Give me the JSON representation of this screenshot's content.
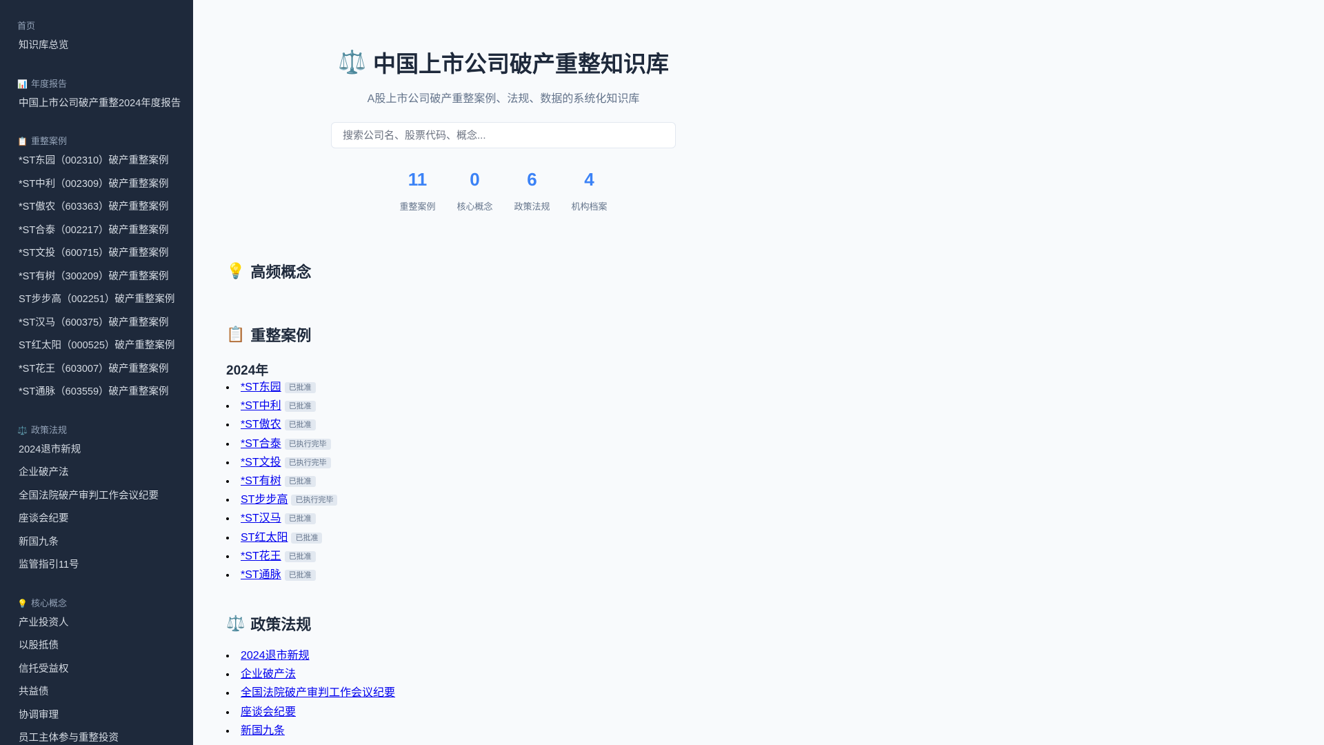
{
  "sidebar": {
    "sections": [
      {
        "title": "首页",
        "icon": "",
        "items": [
          "知识库总览"
        ]
      },
      {
        "title": "年度报告",
        "icon": "📊",
        "items": [
          "中国上市公司破产重整2024年度报告"
        ]
      },
      {
        "title": "重整案例",
        "icon": "📋",
        "items": [
          "*ST东园（002310）破产重整案例",
          "*ST中利（002309）破产重整案例",
          "*ST傲农（603363）破产重整案例",
          "*ST合泰（002217）破产重整案例",
          "*ST文投（600715）破产重整案例",
          "*ST有树（300209）破产重整案例",
          "ST步步高（002251）破产重整案例",
          "*ST汉马（600375）破产重整案例",
          "ST红太阳（000525）破产重整案例",
          "*ST花王（603007）破产重整案例",
          "*ST通脉（603559）破产重整案例"
        ]
      },
      {
        "title": "政策法规",
        "icon": "⚖️",
        "items": [
          "2024退市新规",
          "企业破产法",
          "全国法院破产审判工作会议纪要",
          "座谈会纪要",
          "新国九条",
          "监管指引11号"
        ]
      },
      {
        "title": "核心概念",
        "icon": "💡",
        "items": [
          "产业投资人",
          "以股抵债",
          "信托受益权",
          "共益债",
          "协调审理",
          "员工主体参与重整投资"
        ]
      }
    ]
  },
  "hero": {
    "icon": "⚖️",
    "title": "中国上市公司破产重整知识库",
    "subtitle": "A股上市公司破产重整案例、法规、数据的系统化知识库",
    "search_placeholder": "搜索公司名、股票代码、概念..."
  },
  "stats": [
    {
      "value": "11",
      "label": "重整案例"
    },
    {
      "value": "0",
      "label": "核心概念"
    },
    {
      "value": "6",
      "label": "政策法规"
    },
    {
      "value": "4",
      "label": "机构档案"
    }
  ],
  "concepts": {
    "icon": "💡",
    "title": "高频概念"
  },
  "cases": {
    "icon": "📋",
    "title": "重整案例",
    "year": "2024年",
    "items": [
      {
        "name": "*ST东园",
        "status": "已批准"
      },
      {
        "name": "*ST中利",
        "status": "已批准"
      },
      {
        "name": "*ST傲农",
        "status": "已批准"
      },
      {
        "name": "*ST合泰",
        "status": "已执行完毕"
      },
      {
        "name": "*ST文投",
        "status": "已执行完毕"
      },
      {
        "name": "*ST有树",
        "status": "已批准"
      },
      {
        "name": "ST步步高",
        "status": "已执行完毕"
      },
      {
        "name": "*ST汉马",
        "status": "已批准"
      },
      {
        "name": "ST红太阳",
        "status": "已批准"
      },
      {
        "name": "*ST花王",
        "status": "已批准"
      },
      {
        "name": "*ST通脉",
        "status": "已批准"
      }
    ]
  },
  "policies": {
    "icon": "⚖️",
    "title": "政策法规",
    "items": [
      "2024退市新规",
      "企业破产法",
      "全国法院破产审判工作会议纪要",
      "座谈会纪要",
      "新国九条"
    ]
  }
}
